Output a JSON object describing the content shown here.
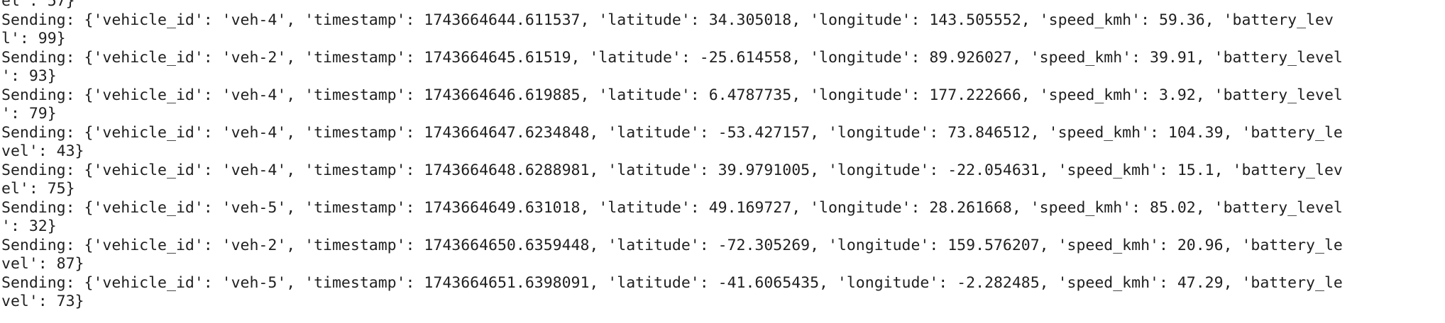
{
  "terminal": {
    "lines": [
      "el': 57}",
      "Sending: {'vehicle_id': 'veh-4', 'timestamp': 1743664644.611537, 'latitude': 34.305018, 'longitude': 143.505552, 'speed_kmh': 59.36, 'battery_lev",
      "l': 99}",
      "Sending: {'vehicle_id': 'veh-2', 'timestamp': 1743664645.61519, 'latitude': -25.614558, 'longitude': 89.926027, 'speed_kmh': 39.91, 'battery_level",
      "': 93}",
      "Sending: {'vehicle_id': 'veh-4', 'timestamp': 1743664646.619885, 'latitude': 6.4787735, 'longitude': 177.222666, 'speed_kmh': 3.92, 'battery_level",
      "': 79}",
      "Sending: {'vehicle_id': 'veh-4', 'timestamp': 1743664647.6234848, 'latitude': -53.427157, 'longitude': 73.846512, 'speed_kmh': 104.39, 'battery_le",
      "vel': 43}",
      "Sending: {'vehicle_id': 'veh-4', 'timestamp': 1743664648.6288981, 'latitude': 39.9791005, 'longitude': -22.054631, 'speed_kmh': 15.1, 'battery_lev",
      "el': 75}",
      "Sending: {'vehicle_id': 'veh-5', 'timestamp': 1743664649.631018, 'latitude': 49.169727, 'longitude': 28.261668, 'speed_kmh': 85.02, 'battery_level",
      "': 32}",
      "Sending: {'vehicle_id': 'veh-2', 'timestamp': 1743664650.6359448, 'latitude': -72.305269, 'longitude': 159.576207, 'speed_kmh': 20.96, 'battery_le",
      "vel': 87}",
      "Sending: {'vehicle_id': 'veh-5', 'timestamp': 1743664651.6398091, 'latitude': -41.6065435, 'longitude': -2.282485, 'speed_kmh': 47.29, 'battery_le",
      "vel': 73}"
    ]
  }
}
